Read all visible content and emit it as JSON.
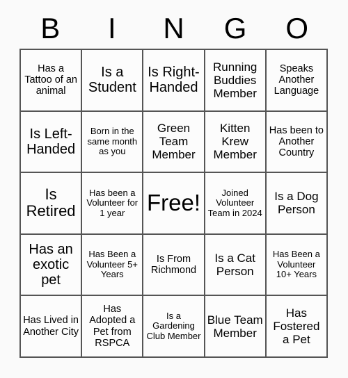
{
  "header": {
    "letters": [
      "B",
      "I",
      "N",
      "G",
      "O"
    ]
  },
  "grid": {
    "rows": 5,
    "columns": 5,
    "border_color": "#555555",
    "cell_background": "#fcfcfc",
    "page_background": "#fafafa",
    "text_color": "#000000",
    "cells": [
      {
        "text": "Has a Tattoo of an animal",
        "size": "s"
      },
      {
        "text": "Is a Student",
        "size": "l"
      },
      {
        "text": "Is Right-Handed",
        "size": "l"
      },
      {
        "text": "Running Buddies Member",
        "size": "m"
      },
      {
        "text": "Speaks Another Language",
        "size": "s"
      },
      {
        "text": "Is Left-Handed",
        "size": "l"
      },
      {
        "text": "Born in the same month as you",
        "size": "xs"
      },
      {
        "text": "Green Team Member",
        "size": "m"
      },
      {
        "text": "Kitten Krew Member",
        "size": "m"
      },
      {
        "text": "Has been to Another Country",
        "size": "s"
      },
      {
        "text": "Is Retired",
        "size": "xl"
      },
      {
        "text": "Has been a Volunteer for 1 year",
        "size": "xs"
      },
      {
        "text": "Free!",
        "size": "free"
      },
      {
        "text": "Joined Volunteer Team in 2024",
        "size": "xs"
      },
      {
        "text": "Is a Dog Person",
        "size": "m"
      },
      {
        "text": "Has an exotic pet",
        "size": "l"
      },
      {
        "text": "Has Been a Volunteer 5+ Years",
        "size": "xs"
      },
      {
        "text": "Is From Richmond",
        "size": "s"
      },
      {
        "text": "Is a Cat Person",
        "size": "m"
      },
      {
        "text": "Has Been a Volunteer 10+ Years",
        "size": "xs"
      },
      {
        "text": "Has Lived in Another City",
        "size": "s"
      },
      {
        "text": "Has Adopted a Pet from RSPCA",
        "size": "s"
      },
      {
        "text": "Is a Gardening Club Member",
        "size": "xs"
      },
      {
        "text": "Blue Team Member",
        "size": "m"
      },
      {
        "text": "Has Fostered a Pet",
        "size": "m"
      }
    ]
  }
}
